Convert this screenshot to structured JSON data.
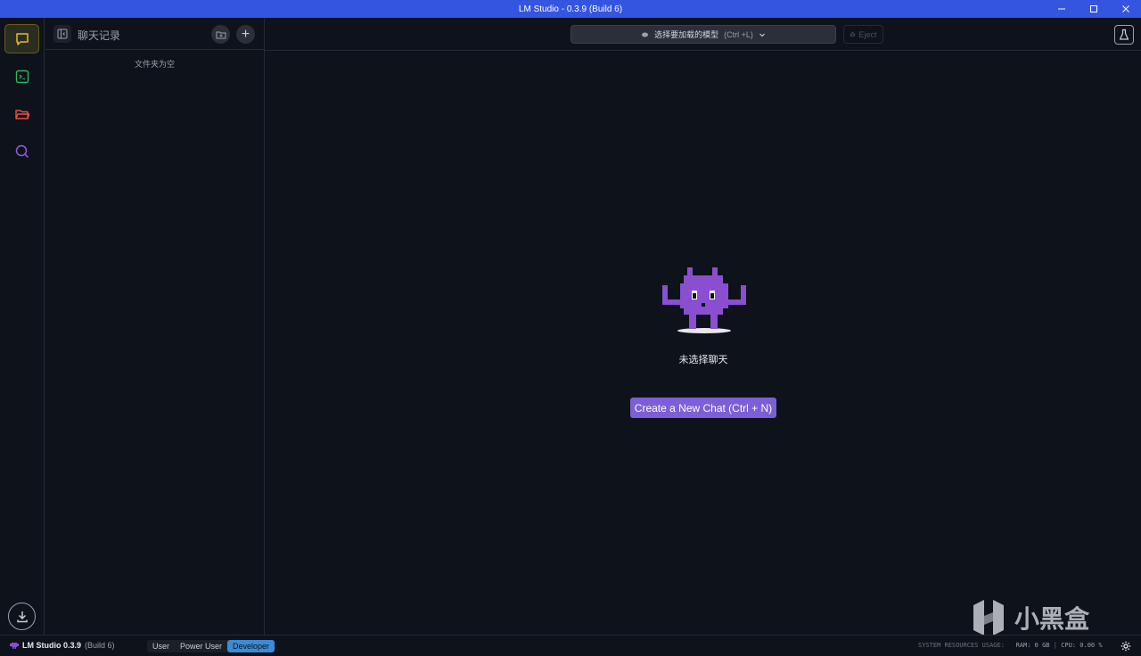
{
  "window": {
    "title": "LM Studio - 0.3.9 (Build 6)",
    "min_icon": "minimize-icon",
    "max_icon": "maximize-icon",
    "close_icon": "close-icon"
  },
  "rail": {
    "items": [
      {
        "name": "chat",
        "icon": "chat-bubble-icon",
        "color": "#e8b731",
        "active": true
      },
      {
        "name": "developer",
        "icon": "terminal-icon",
        "color": "#2fb55d",
        "active": false
      },
      {
        "name": "models",
        "icon": "folder-icon",
        "color": "#e5534b",
        "active": false
      },
      {
        "name": "discover",
        "icon": "search-icon",
        "color": "#9a5cd6",
        "active": false
      }
    ],
    "download_icon": "download-icon"
  },
  "sidebar": {
    "title": "聊天记录",
    "empty_text": "文件夹为空",
    "new_chat_symbol": "+"
  },
  "topbar": {
    "model_select_label": "选择要加载的模型",
    "model_select_shortcut": "(Ctrl +L)",
    "eject_label": "Eject"
  },
  "main": {
    "empty_title": "未选择聊天",
    "create_button": "Create a New Chat (Ctrl + N)"
  },
  "statusbar": {
    "app_name": "LM Studio 0.3.9",
    "build": "(Build 6)",
    "modes": [
      "User",
      "Power User",
      "Developer"
    ],
    "active_mode": "Developer",
    "resources_label": "SYSTEM RESOURCES USAGE:",
    "ram": "RAM: 0 GB",
    "cpu": "CPU: 0.00 %"
  },
  "watermark": {
    "text": "小黑盒"
  },
  "colors": {
    "titlebar": "#3455e0",
    "background": "#0e121a",
    "accent": "#7c5fd6",
    "mascot": "#8a4fd0"
  }
}
